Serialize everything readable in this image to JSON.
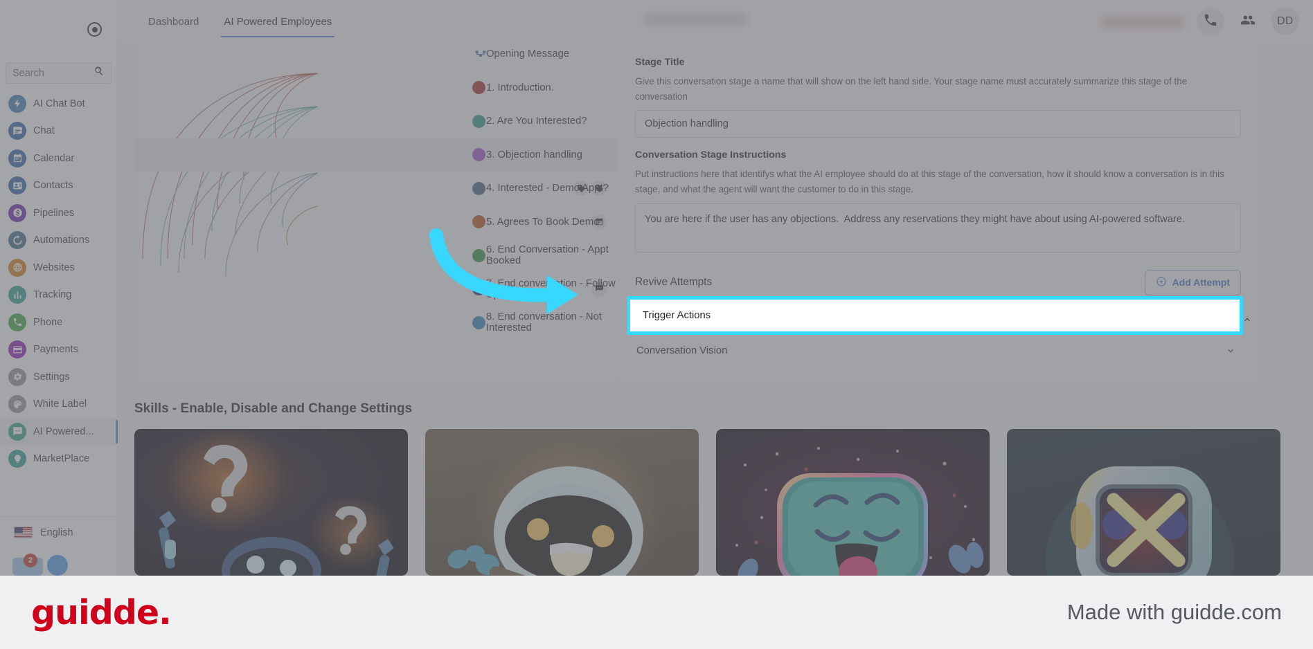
{
  "sidebar": {
    "search_placeholder": "Search",
    "record_icon": "record-indicator-icon",
    "items": [
      {
        "label": "AI Chat Bot",
        "icon": "bolt-icon",
        "color": "#3c7cb0",
        "active": false
      },
      {
        "label": "Chat",
        "icon": "chat-icon",
        "color": "#2d62a3",
        "active": false
      },
      {
        "label": "Calendar",
        "icon": "calendar-icon",
        "color": "#2d62a3",
        "active": false
      },
      {
        "label": "Contacts",
        "icon": "contact-icon",
        "color": "#2d62a3",
        "active": false
      },
      {
        "label": "Pipelines",
        "icon": "dollar-icon",
        "color": "#6b22a8",
        "active": false
      },
      {
        "label": "Automations",
        "icon": "gear-flow-icon",
        "color": "#3b6a85",
        "active": false
      },
      {
        "label": "Websites",
        "icon": "globe-icon",
        "color": "#d07c12",
        "active": false
      },
      {
        "label": "Tracking",
        "icon": "bars-icon",
        "color": "#2f9c8e",
        "active": false
      },
      {
        "label": "Phone",
        "icon": "phone-icon",
        "color": "#3ba43f",
        "active": false
      },
      {
        "label": "Payments",
        "icon": "card-icon",
        "color": "#8b1fb0",
        "active": false
      },
      {
        "label": "Settings",
        "icon": "gear-icon",
        "color": "#8b9096",
        "active": false
      },
      {
        "label": "White Label",
        "icon": "palette-icon",
        "color": "#8b9096",
        "active": false
      },
      {
        "label": "AI Powered...",
        "icon": "ai-chat-icon",
        "color": "#3aa08c",
        "active": true
      },
      {
        "label": "MarketPlace",
        "icon": "bulb-icon",
        "color": "#2f9c8e",
        "active": false
      }
    ],
    "language": "English",
    "notification_count": "2"
  },
  "topbar": {
    "tabs": [
      {
        "label": "Dashboard",
        "active": false
      },
      {
        "label": "AI Powered Employees",
        "active": true
      }
    ],
    "call_icon": "phone-icon",
    "team_icon": "people-icon",
    "avatar_initials": "DD"
  },
  "stage_panel": {
    "opening": {
      "label": "Opening Message",
      "icon": "flow-start-icon"
    },
    "stages": [
      {
        "label": "1. Introduction.",
        "color": "#a32b26",
        "selected": false,
        "icons": []
      },
      {
        "label": "2. Are You Interested?",
        "color": "#2f9486",
        "selected": false,
        "icons": []
      },
      {
        "label": "3. Objection handling",
        "color": "#9b4cc0",
        "selected": true,
        "icons": []
      },
      {
        "label": "4. Interested - Demo Appt?",
        "color": "#45617f",
        "selected": false,
        "icons": [
          "tag-icon",
          "tag-icon"
        ]
      },
      {
        "label": "5. Agrees To Book Demo",
        "color": "#b4511a",
        "selected": false,
        "icons": [
          "calendar-icon"
        ]
      },
      {
        "label": "6. End Conversation - Appt Booked",
        "color": "#2f8f41",
        "selected": false,
        "icons": []
      },
      {
        "label": "7. End conversation - Follow Up",
        "color": "#2c2b7a",
        "selected": false,
        "icons": [
          "message-icon"
        ]
      },
      {
        "label": "8. End conversation - Not Interested",
        "color": "#3080b8",
        "selected": false,
        "icons": []
      }
    ]
  },
  "detail_panel": {
    "stage_title_label": "Stage Title",
    "stage_title_help": "Give this conversation stage a name that will show on the left hand side. Your stage name must accurately summarize this stage of the conversation",
    "stage_title_value": "Objection handling",
    "instructions_label": "Conversation Stage Instructions",
    "instructions_help": "Put instructions here that identifys what the AI employee should do at this stage of the conversation, how it should know a conversation is in this stage, and what the agent will want the customer to do in this stage.",
    "instructions_value": "You are here if the user has any objections.  Address any reservations they might have about using AI-powered software.",
    "revive_attempts_label": "Revive Attempts",
    "add_attempt_label": "Add Attempt",
    "trigger_actions_label": "Trigger Actions",
    "conversation_vision_label": "Conversation Vision",
    "highlight_color": "#37d7ff"
  },
  "skills": {
    "heading": "Skills - Enable, Disable and Change Settings",
    "cards": [
      {
        "art": "robot-question-marks"
      },
      {
        "art": "robot-smiling-warm"
      },
      {
        "art": "robot-happy-tongue"
      },
      {
        "art": "robot-red-x"
      }
    ]
  },
  "footer": {
    "logo": "guidde.",
    "made_with": "Made with guidde.com"
  }
}
